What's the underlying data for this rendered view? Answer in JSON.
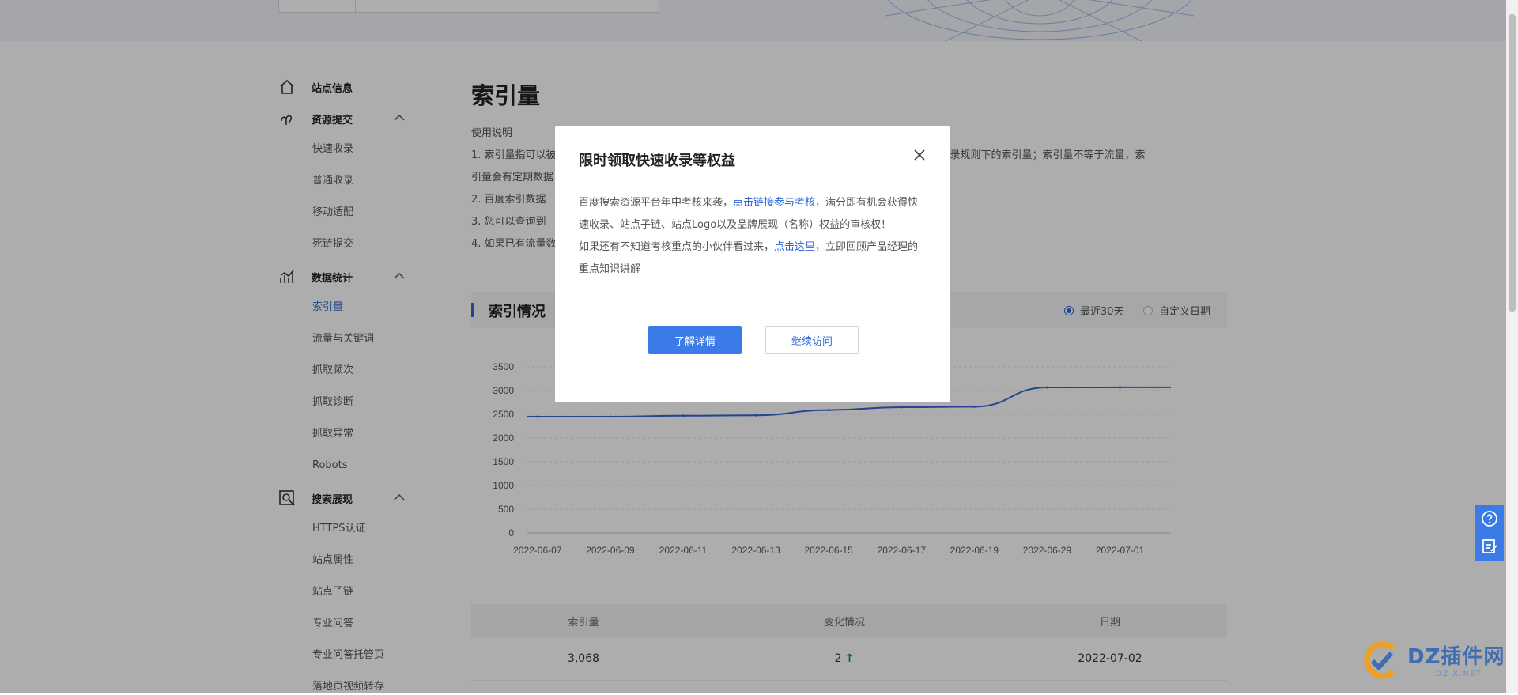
{
  "sidebar": {
    "groups": [
      {
        "label": "站点信息",
        "icon": "home-icon",
        "items": []
      },
      {
        "label": "资源提交",
        "icon": "submit-icon",
        "items": [
          "快速收录",
          "普通收录",
          "移动适配",
          "死链提交"
        ]
      },
      {
        "label": "数据统计",
        "icon": "stats-icon",
        "items": [
          "索引量",
          "流量与关键词",
          "抓取频次",
          "抓取诊断",
          "抓取异常",
          "Robots"
        ]
      },
      {
        "label": "搜索展现",
        "icon": "search-display-icon",
        "items": [
          "HTTPS认证",
          "站点属性",
          "站点子链",
          "专业问答",
          "专业问答托管页",
          "落地页视频转存"
        ]
      }
    ],
    "active_item": "索引量"
  },
  "main": {
    "title": "索引量",
    "usage_title": "使用说明",
    "usage_lines": [
      "1. 索引量指可以被",
      "引量会有定期数据",
      "2. 百度索引数据",
      "3. 您可以查询到",
      "4. 如果已有流量数"
    ],
    "usage_line1_tail": "，查看某一目录规则下的索引量；索引量不等于流量，索",
    "section_title": "索引情况",
    "radio_recent": "最近30天",
    "radio_custom": "自定义日期"
  },
  "chart_data": {
    "type": "line",
    "x": [
      "2022-06-07",
      "2022-06-09",
      "2022-06-11",
      "2022-06-13",
      "2022-06-15",
      "2022-06-17",
      "2022-06-19",
      "2022-06-29",
      "2022-07-01"
    ],
    "ylim": [
      0,
      3500
    ],
    "yticks": [
      0,
      500,
      1000,
      1500,
      2000,
      2500,
      3000,
      3500
    ],
    "series": [
      {
        "values": [
          2450,
          2450,
          2470,
          2480,
          2590,
          2650,
          2660,
          3066,
          3068
        ]
      }
    ],
    "grid": true
  },
  "table": {
    "headers": [
      "索引量",
      "变化情况",
      "日期"
    ],
    "rows": [
      {
        "count": "3,068",
        "change": "2",
        "date": "2022-07-02"
      }
    ]
  },
  "modal": {
    "title": "限时领取快速收录等权益",
    "p1_before": "百度搜索资源平台年中考核来袭，",
    "p1_link": "点击链接参与考核",
    "p1_after": "，满分即有机会获得快速收录、站点子链、站点Logo以及品牌展现（名称）权益的审核权！",
    "p2_before": "如果还有不知道考核重点的小伙伴看过来，",
    "p2_link": "点击这里",
    "p2_after": "，立即回顾产品经理的重点知识讲解",
    "primary_button": "了解详情",
    "secondary_button": "继续访问"
  },
  "watermark": {
    "text": "DZ插件网",
    "sub": "DZ-X.NET"
  },
  "colors": {
    "accent": "#3066d6",
    "primary_button": "#3a7be8",
    "up_arrow": "#1a8a3c"
  }
}
